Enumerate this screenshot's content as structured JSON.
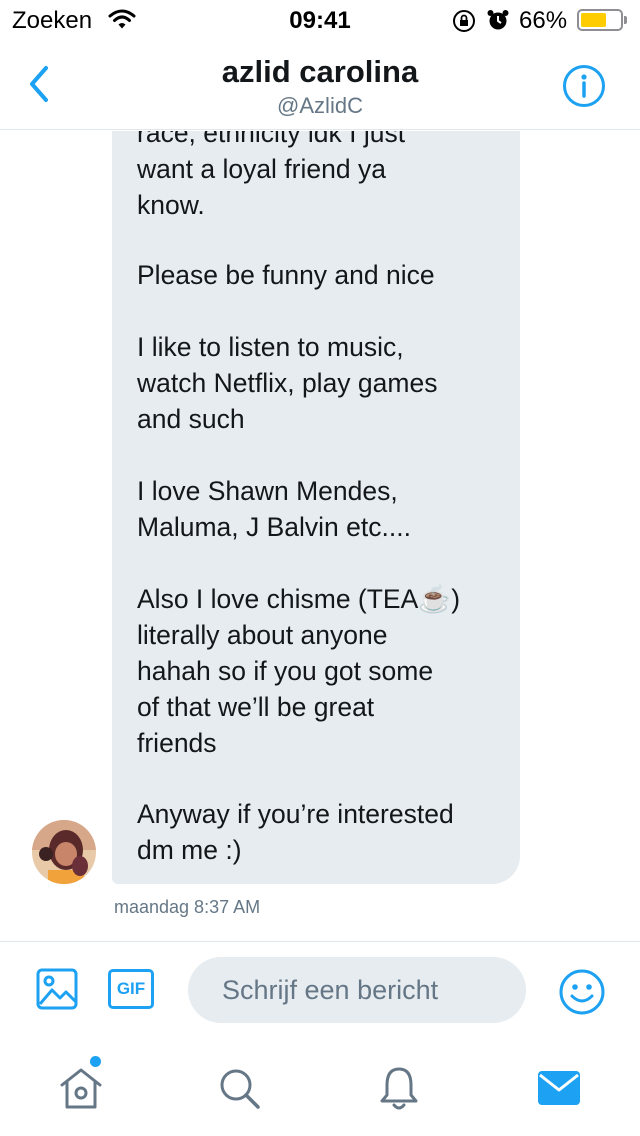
{
  "status_bar": {
    "carrier": "Zoeken",
    "time": "09:41",
    "battery": "66%",
    "battery_level": 0.66
  },
  "header": {
    "title": "azlid carolina",
    "handle": "@AzlidC"
  },
  "message": {
    "paragraphs": [
      "race, ethnicity idk I just\nwant a loyal friend ya\nknow.",
      "Please be funny and nice",
      "I like to listen to music,\nwatch Netflix, play games\nand such",
      "I love Shawn Mendes,\nMaluma, J Balvin etc....",
      "Also I love chisme (TEA☕)\nliterally about anyone\nhahah so if you got some\nof that we’ll be great\nfriends",
      "Anyway if you’re interested\ndm me :)"
    ],
    "timestamp": "maandag 8:37 AM"
  },
  "composer": {
    "gif_label": "GIF",
    "placeholder": "Schrijf een bericht"
  },
  "colors": {
    "accent": "#1da1f2",
    "bubble": "#e6ecf0",
    "secondary_text": "#657786"
  },
  "icons": {
    "back": "chevron-left-icon",
    "info": "info-icon",
    "image": "image-icon",
    "emoji": "emoji-icon",
    "home": "home-icon",
    "search": "search-icon",
    "notifications": "bell-icon",
    "messages": "mail-icon"
  }
}
